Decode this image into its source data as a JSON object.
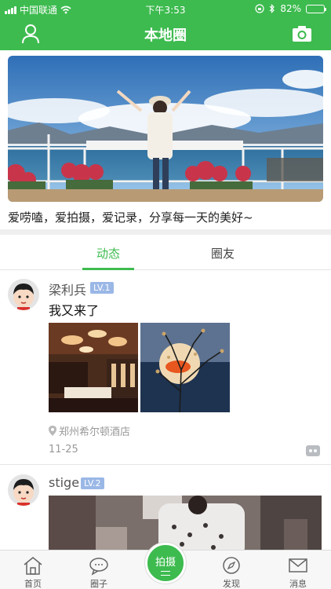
{
  "status_bar": {
    "carrier": "中国联通",
    "time": "下午3:53",
    "battery": "82%",
    "battery_level": 0.82
  },
  "nav": {
    "title": "本地圈",
    "left_icon": "person-icon",
    "right_icon": "camera-icon"
  },
  "tagline": "爱唠嗑，爱拍摄，爱记录，分享每一天的美好~",
  "tabs": [
    {
      "label": "动态",
      "active": true
    },
    {
      "label": "圈友",
      "active": false
    }
  ],
  "posts": [
    {
      "user": "梁利兵",
      "level": "LV.1",
      "text": "我又来了",
      "location": "郑州希尔顿酒店",
      "date": "11-25"
    },
    {
      "user": "stige",
      "level": "LV.2"
    }
  ],
  "tab_bar": [
    {
      "label": "首页",
      "icon": "home-icon"
    },
    {
      "label": "圈子",
      "icon": "chat-bubble-icon"
    },
    {
      "label": "拍摄",
      "icon": "shoot-icon"
    },
    {
      "label": "发现",
      "icon": "compass-icon"
    },
    {
      "label": "消息",
      "icon": "mail-icon"
    }
  ],
  "colors": {
    "brand": "#3dbb4f",
    "level_badge": "#9ab7e6"
  }
}
